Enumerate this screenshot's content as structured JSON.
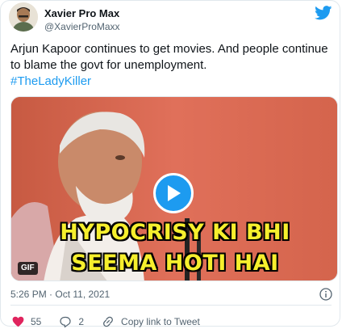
{
  "author": {
    "name": "Xavier Pro Max",
    "handle": "@XavierProMaxx"
  },
  "tweet": {
    "text": "Arjun Kapoor continues to get movies. And people continue to blame the govt for unemployment.",
    "hashtag": "#TheLadyKiller"
  },
  "media": {
    "caption_line1": "HYPOCRISY KI BHI",
    "caption_line2": "SEEMA HOTI HAI",
    "badge": "GIF"
  },
  "meta": {
    "timestamp": "5:26 PM · Oct 11, 2021"
  },
  "actions": {
    "likes": "55",
    "replies": "2",
    "copy_link_label": "Copy link to Tweet"
  },
  "colors": {
    "accent": "#1d9bf0",
    "like": "#e0245e",
    "caption": "#f6ef2d"
  }
}
